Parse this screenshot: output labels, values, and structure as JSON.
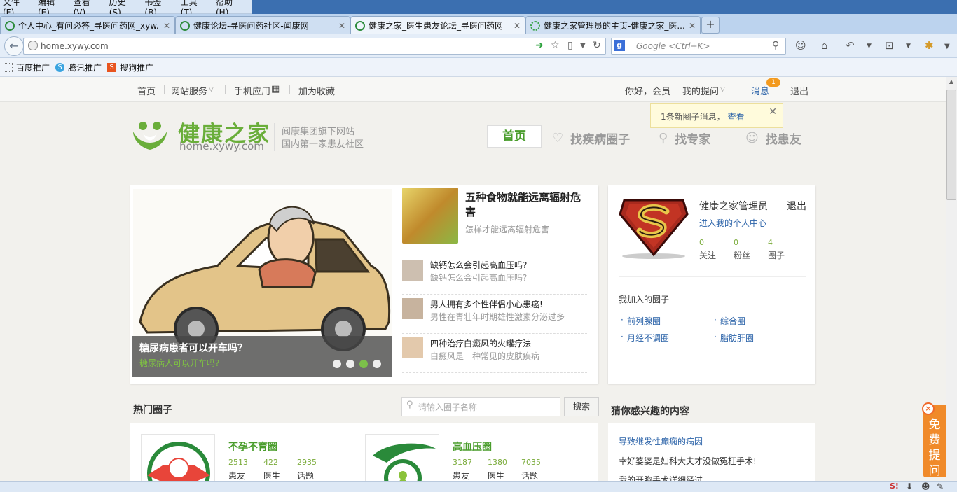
{
  "browser": {
    "menu": [
      "文件(F)",
      "编辑(E)",
      "查看(V)",
      "历史(S)",
      "书签(B)",
      "工具(T)",
      "帮助(H)"
    ],
    "tabs": [
      {
        "label": "个人中心_有问必答_寻医问药网_xyw..."
      },
      {
        "label": "健康论坛-寻医问药社区-闻康网"
      },
      {
        "label": "健康之家_医生患友论坛_寻医问药网"
      },
      {
        "label": "健康之家管理员的主页-健康之家_医..."
      }
    ],
    "new_tab": "+",
    "url": "home.xywy.com",
    "search_placeholder": "Google <Ctrl+K>",
    "bookmarks": [
      "百度推广",
      "腾讯推广",
      "搜狗推广"
    ]
  },
  "sitebar": {
    "home": "首页",
    "services": "网站服务",
    "mobile": "手机应用",
    "favorite": "加为收藏",
    "greeting": "你好，会员",
    "my_questions": "我的提问",
    "messages": "消息",
    "message_count": "1",
    "logout": "退出"
  },
  "notice": {
    "text": "1条新圈子消息，",
    "link": "查看"
  },
  "header": {
    "logo_title": "健康之家",
    "logo_url": "home.xywy.com",
    "tagline1": "闻康集团旗下网站",
    "tagline2": "国内第一家患友社区",
    "nav": [
      "首页",
      "找疾病圈子",
      "找专家",
      "找患友"
    ]
  },
  "slider": {
    "title": "糖尿病患者可以开车吗？",
    "subtitle": "糖尿病人可以开车吗?",
    "dots": 4,
    "active_dot": 3
  },
  "featured": {
    "title": "五种食物就能远离辐射危害",
    "subtitle": "怎样才能远离辐射危害"
  },
  "news": [
    {
      "title": "缺钙怎么会引起高血压吗?",
      "subtitle": "缺钙怎么会引起高血压吗?"
    },
    {
      "title": "男人拥有多个性伴侣小心患癌!",
      "subtitle": "男性在青壮年时期雄性激素分泌过多"
    },
    {
      "title": "四种治疗白癜风的火罐疗法",
      "subtitle": "白癜风是一种常见的皮肤疾病"
    }
  ],
  "user": {
    "name": "健康之家管理员",
    "logout": "退出",
    "center_link": "进入我的个人中心",
    "stats": [
      {
        "value": "0",
        "label": "关注"
      },
      {
        "value": "0",
        "label": "粉丝"
      },
      {
        "value": "4",
        "label": "圈子"
      }
    ],
    "joined_title": "我加入的圈子",
    "circles": [
      "前列腺圈",
      "综合圈",
      "月经不调圈",
      "脂肪肝圈"
    ]
  },
  "hot": {
    "title": "热门圈子",
    "search_placeholder": "请输入圈子名称",
    "search_button": "搜索",
    "items": [
      {
        "name": "不孕不育圈",
        "stats": [
          {
            "value": "2513",
            "label": "患友"
          },
          {
            "value": "422",
            "label": "医生"
          },
          {
            "value": "2935",
            "label": "话题"
          }
        ]
      },
      {
        "name": "高血压圈",
        "stats": [
          {
            "value": "3187",
            "label": "患友"
          },
          {
            "value": "1380",
            "label": "医生"
          },
          {
            "value": "7035",
            "label": "话题"
          }
        ]
      }
    ]
  },
  "guess": {
    "title": "猜你感兴趣的内容",
    "items": [
      "导致继发性癫痫的病因",
      "幸好婆婆是妇科大夫才没做冤枉手术!",
      "我的开胸手术详细经过"
    ]
  },
  "float": {
    "label": "免费提问",
    "close": "×"
  },
  "colors": {
    "brand_green": "#6aae3a",
    "link_blue": "#2a62a8",
    "badge_orange": "#f39a1e"
  }
}
